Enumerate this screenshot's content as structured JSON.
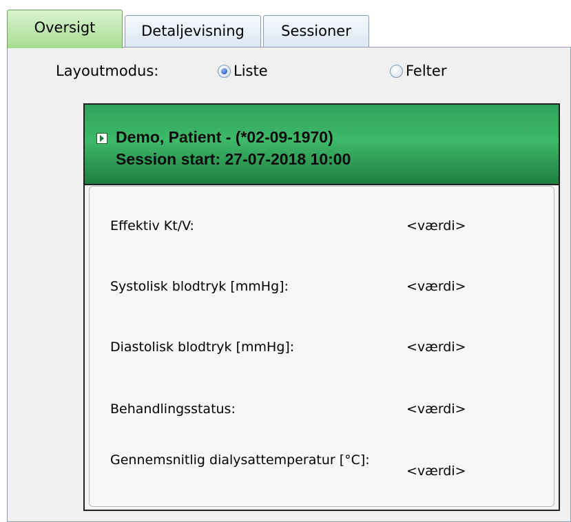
{
  "tabs": [
    {
      "label": "Oversigt",
      "active": true
    },
    {
      "label": "Detaljevisning",
      "active": false
    },
    {
      "label": "Sessioner",
      "active": false
    }
  ],
  "layout": {
    "label": "Layoutmodus:",
    "options": [
      {
        "label": "Liste",
        "selected": true
      },
      {
        "label": "Felter",
        "selected": false
      }
    ]
  },
  "patient": {
    "line1": "Demo, Patient - (*02-09-1970)",
    "line2": "Session start: 27-07-2018 10:00"
  },
  "rows": [
    {
      "label": "Effektiv Kt/V:",
      "value": "<værdi>"
    },
    {
      "label": "Systolisk blodtryk [mmHg]:",
      "value": "<værdi>"
    },
    {
      "label": "Diastolisk blodtryk [mmHg]:",
      "value": "<værdi>"
    },
    {
      "label": "Behandlingsstatus:",
      "value": "<værdi>"
    },
    {
      "label": "Gennemsnitlig dialysattemperatur [°C]:",
      "value": "<værdi>"
    }
  ],
  "colors": {
    "header_green": "#3fb96a",
    "active_tab_green": "#a8dc92",
    "radio_selected": "#1e4fb8"
  }
}
